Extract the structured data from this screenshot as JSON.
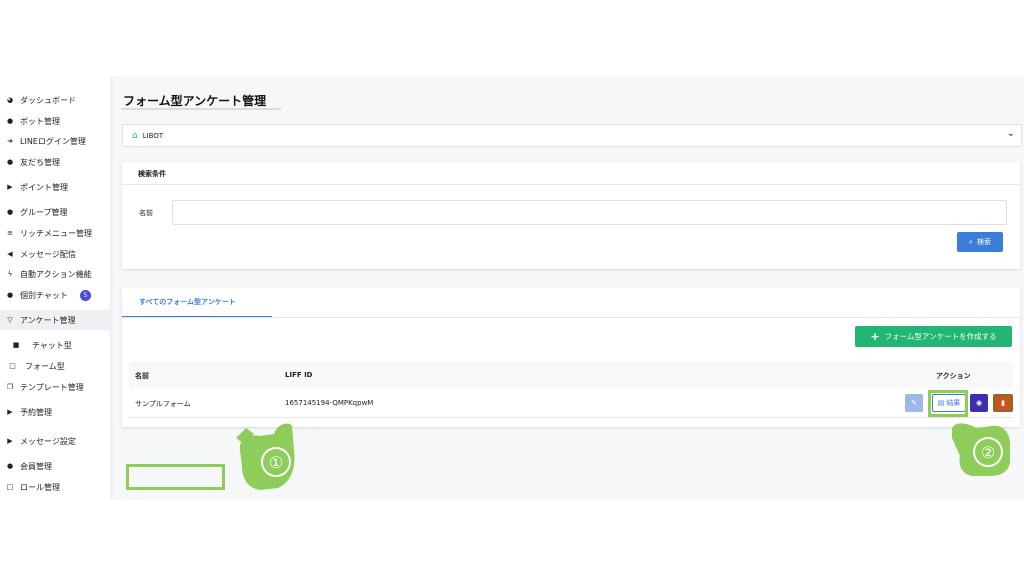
{
  "sidebar": {
    "items": [
      {
        "icon": "dashboard-icon",
        "glyph": "◕",
        "label": "ダッシュボード"
      },
      {
        "icon": "robot-icon",
        "glyph": "●",
        "label": "ボット管理"
      },
      {
        "icon": "login-icon",
        "glyph": "➜",
        "label": "LINEログイン管理"
      },
      {
        "icon": "user-icon",
        "glyph": "●",
        "label": "友だち管理"
      },
      {
        "icon": "caret-right-icon",
        "glyph": "▶",
        "label": "ポイント管理"
      },
      {
        "icon": "users-icon",
        "glyph": "●",
        "label": "グループ管理"
      },
      {
        "icon": "list-icon",
        "glyph": "≡",
        "label": "リッチメニュー管理"
      },
      {
        "icon": "megaphone-icon",
        "glyph": "◀",
        "label": "メッセージ配信"
      },
      {
        "icon": "bolt-icon",
        "glyph": "ϟ",
        "label": "自動アクション機能"
      },
      {
        "icon": "chat-icon",
        "glyph": "●",
        "label": "個別チャット",
        "badge": "5"
      },
      {
        "icon": "caret-down-icon",
        "glyph": "▽",
        "label": "アンケート管理"
      },
      {
        "icon": "clipboard-icon",
        "glyph": "■",
        "label": "チャット型"
      },
      {
        "icon": "clipboard-outline-icon",
        "glyph": "□",
        "label": "フォーム型"
      },
      {
        "icon": "template-icon",
        "glyph": "❐",
        "label": "テンプレート管理"
      },
      {
        "icon": "caret-right-icon",
        "glyph": "▶",
        "label": "予約管理"
      },
      {
        "icon": "caret-right-icon",
        "glyph": "▶",
        "label": "メッセージ設定"
      },
      {
        "icon": "user-icon",
        "glyph": "●",
        "label": "会員管理"
      },
      {
        "icon": "clipboard-outline-icon",
        "glyph": "□",
        "label": "ロール管理"
      }
    ]
  },
  "main": {
    "title": "フォーム型アンケート管理",
    "bot_select": "LIBOT",
    "search": {
      "header": "検索条件",
      "name_label": "名前",
      "name_value": "",
      "button": "検索"
    },
    "tabs": [
      "すべてのフォーム型アンケート"
    ],
    "create_button": "フォーム型アンケートを作成する",
    "table": {
      "columns": [
        "名前",
        "LIFF ID",
        "アクション"
      ],
      "rows": [
        {
          "name": "サンプルフォーム",
          "liff_id": "1657145194-QMPKqpwM",
          "result_label": "結果"
        }
      ]
    }
  },
  "annotations": {
    "step1": "①",
    "step2": "②"
  },
  "colors": {
    "accent": "#3b7dd8",
    "create": "#22b573",
    "highlight": "#8fcd5a",
    "chat_badge": "#4a4ad8"
  }
}
